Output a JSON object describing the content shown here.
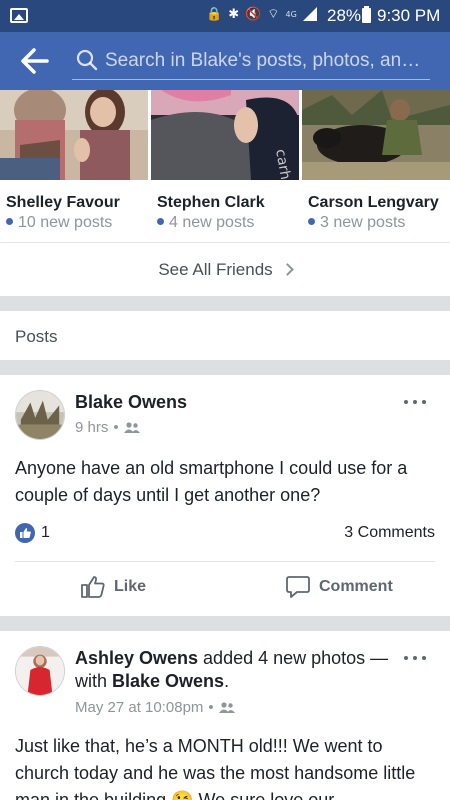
{
  "status_bar": {
    "network": "4G",
    "battery": "28%",
    "time": "9:30 PM"
  },
  "header": {
    "search_placeholder": "Search in Blake's posts, photos, an…"
  },
  "friends": [
    {
      "name": "Shelley Favour",
      "new_posts": "10 new posts"
    },
    {
      "name": "Stephen Clark",
      "new_posts": "4 new posts"
    },
    {
      "name": "Carson Lengvary",
      "new_posts": "3 new posts"
    }
  ],
  "see_all_label": "See All Friends",
  "posts_section_label": "Posts",
  "posts": [
    {
      "author": "Blake Owens",
      "time": "9 hrs",
      "text": "Anyone have an old smartphone I could use for a couple of days until I get another one?",
      "likes": "1",
      "comments": "3 Comments",
      "like_label": "Like",
      "comment_label": "Comment"
    },
    {
      "author": "Ashley Owens",
      "action_text": " added 4 new photos — with ",
      "tagged": "Blake Owens",
      "tail": ".",
      "time": "May 27 at 10:08pm",
      "text": "Just like that, he’s a MONTH old!!! We went to church today and he was the most handsome little man in the building 😘 We sure love our"
    }
  ],
  "colors": {
    "brand": "#4267b2",
    "status_bar": "#29487d",
    "feed_bg": "#dddfe2"
  }
}
